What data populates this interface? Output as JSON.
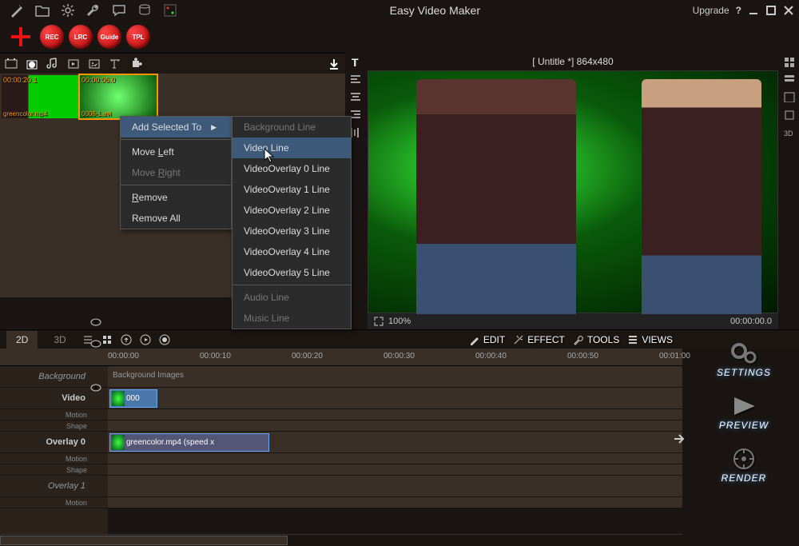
{
  "app": {
    "title": "Easy Video Maker",
    "upgrade": "Upgrade"
  },
  "toolbar": {
    "rec": "REC",
    "lrc": "LRC",
    "guide": "Guide",
    "tpl": "TPL"
  },
  "preview": {
    "title": "[ Untitle *]  864x480",
    "zoom": "100%",
    "timecode": "00:00:00.0"
  },
  "clips": [
    {
      "time": "00:00:20.1",
      "name": "greencolor.mp4"
    },
    {
      "time": "00:00:06.0",
      "name": "0006-1.avi"
    }
  ],
  "menu1": {
    "add_selected": "Add Selected To",
    "move_left": "Move Left",
    "move_right": "Move Right",
    "remove": "Remove",
    "remove_all": "Remove All"
  },
  "menu2": {
    "background": "Background Line",
    "video": "Video Line",
    "vo0": "VideoOverlay 0 Line",
    "vo1": "VideoOverlay 1 Line",
    "vo2": "VideoOverlay 2 Line",
    "vo3": "VideoOverlay 3 Line",
    "vo4": "VideoOverlay 4 Line",
    "vo5": "VideoOverlay 5 Line",
    "audio": "Audio Line",
    "music": "Music Line"
  },
  "tabs": {
    "t2d": "2D",
    "t3d": "3D",
    "edit": "EDIT",
    "effect": "EFFECT",
    "tools": "TOOLS",
    "views": "VIEWS"
  },
  "ruler": [
    "00:00:00",
    "00:00:10",
    "00:00:20",
    "00:00:30",
    "00:00:40",
    "00:00:50",
    "00:01:00"
  ],
  "tracks": {
    "background": "Background",
    "bg_label": "Background Images",
    "video": "Video",
    "motion": "Motion",
    "shape": "Shape",
    "overlay0": "Overlay 0",
    "overlay1": "Overlay 1",
    "clip_video": "000",
    "clip_overlay": "greencolor.mp4  (speed x"
  },
  "side": {
    "settings": "SETTINGS",
    "preview": "PREVIEW",
    "render": "RENDER"
  }
}
